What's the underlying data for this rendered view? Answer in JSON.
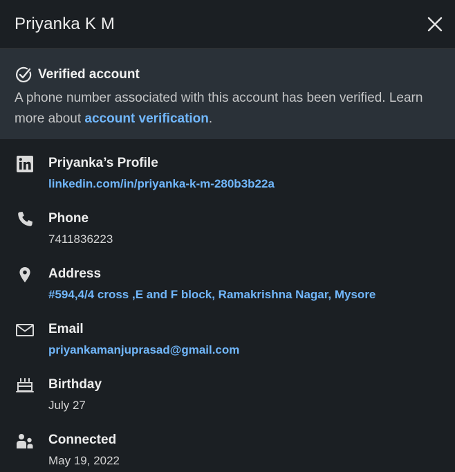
{
  "header": {
    "title": "Priyanka K M"
  },
  "verified": {
    "title": "Verified account",
    "text_before": "A phone number associated with this account has been verified. Learn more about ",
    "link_text": "account verification",
    "text_after": "."
  },
  "sections": {
    "profile": {
      "icon": "linkedin-icon",
      "label": "Priyanka’s Profile",
      "value": "linkedin.com/in/priyanka-k-m-280b3b22a"
    },
    "phone": {
      "icon": "phone-icon",
      "label": "Phone",
      "value": "7411836223"
    },
    "address": {
      "icon": "location-pin-icon",
      "label": "Address",
      "value": "#594,4/4 cross ,E and F block, Ramakrishna Nagar, Mysore"
    },
    "email": {
      "icon": "envelope-icon",
      "label": "Email",
      "value": "priyankamanjuprasad@gmail.com"
    },
    "birthday": {
      "icon": "cake-icon",
      "label": "Birthday",
      "value": "July 27"
    },
    "connected": {
      "icon": "people-icon",
      "label": "Connected",
      "value": "May 19, 2022"
    }
  },
  "colors": {
    "background": "#1b1f23",
    "banner": "#2a3138",
    "link": "#71b7fb",
    "text": "#e9e9e9"
  }
}
